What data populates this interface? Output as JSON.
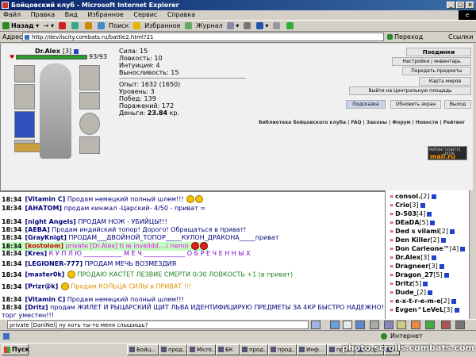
{
  "window": {
    "title": "Бойцовский клуб - Microsoft Internet Explorer"
  },
  "menu": [
    "Файл",
    "Правка",
    "Вид",
    "Избранное",
    "Сервис",
    "Справка"
  ],
  "toolbar": {
    "back": "Назад",
    "search": "Поиск",
    "favorites": "Избранное",
    "journal": "Журнал"
  },
  "address": {
    "label": "Адрес",
    "url": "http://devilscity.combats.ru/battle2.html?21",
    "go": "Переход",
    "links": "Ссылки"
  },
  "character": {
    "name": "Dr.Alex",
    "level": "[3]",
    "hp": "93/93",
    "hp_fraction": 1.0
  },
  "stats": [
    {
      "label": "Сила:",
      "value": "15"
    },
    {
      "label": "Ловкость:",
      "value": "10"
    },
    {
      "label": "Интуиция:",
      "value": "4"
    },
    {
      "label": "Выносливость:",
      "value": "15"
    }
  ],
  "exp": [
    {
      "label": "Опыт:",
      "value": "1632 (1650)"
    },
    {
      "label": "Уровень:",
      "value": "3"
    },
    {
      "label": "Побед:",
      "value": "139"
    },
    {
      "label": "Поражений:",
      "value": "172"
    },
    {
      "label": "Деньги:",
      "value": "23.84",
      "suffix": "кр."
    }
  ],
  "right_buttons": [
    "Поединки",
    "Настройки / инвентарь",
    "Передать предметы",
    "Карта миров",
    "Выйти на Центральную площадь"
  ],
  "bottom_buttons": [
    "Подсказка",
    "Обновить экран",
    "Выход"
  ],
  "library_links": "Библиотека бойцовского клуба | FAQ | Законы | Форум | Новости | Рейтинг",
  "counter": {
    "label": "РЕЙТИНГ",
    "nums": "74584715 20729",
    "brand": "mail.ru"
  },
  "chat": [
    {
      "time": "18:34",
      "user": "[Vitamin C]",
      "text": "Продам немецкий полный шлем!!!",
      "color": "#00007a"
    },
    {
      "time": "18:34",
      "user": "[АНАТОМ]",
      "text": "продам кинжал -Царский- 4/50 - приват =",
      "color": "#00007a"
    },
    {
      "time": "18:34",
      "user": "[night Angels]",
      "text": "ПРОДАМ НОЖ - УБИЙЦЫ!!!",
      "color": "#00007a"
    },
    {
      "time": "18:34",
      "user": "[АЕВА]",
      "text": "Продам индийский топор! Дорого! Обращаться в приват!",
      "color": "#00007a"
    },
    {
      "time": "18:34",
      "user": "[GrayKnigt]",
      "text": "ПРОДАМ___ДВОЙНОЙ_ТОПОР_____КУЛОН_ДРАКОНА_____приват",
      "color": "#00007a"
    },
    {
      "time": "18:34",
      "user": "[kostolom]",
      "text": "private [Dr.Alex] ti ie invalidd....i nemo",
      "color": "#ff00ff",
      "private": true
    },
    {
      "time": "18:34",
      "user": "[Kres]",
      "text": "К У П Л Ю ____________ М Е Ч _____________ О Б Р Е Ч Е Н Н Ы Х",
      "color": "#7a00c8"
    },
    {
      "time": "18:34",
      "user": "[LEGIONER-777]",
      "text": "ПРОДАМ МЕЧЬ ВОЗМЕЗДИЯ",
      "color": "#00007a"
    },
    {
      "time": "18:34",
      "user": "[master0k]",
      "text": "ПРОДАЮ КАСТЕТ ЛЕЗВИЕ СМЕРТИ 0/30 ЛОВКОСТЬ +1 (в приват)",
      "color": "#208020"
    },
    {
      "time": "18:34",
      "user": "[Prizr@k]",
      "text": "Продам КОЛЬЦА СИЛЫ в ПРИВАТ !!!",
      "color": "#e09000"
    },
    {
      "time": "18:34",
      "user": "[Vitamin C]",
      "text": "Продам немецкий полный шлем!!!",
      "color": "#00007a"
    },
    {
      "time": "18:34",
      "user": "[Dritz]",
      "text": "продам ЖИЛЕТ И РЫЦАРСКИЙ ЩИТ ЛЬВА ИДЕНТИФИЦИРУЮ ПРЕДМЕТЫ ЗА 4КР БЫСТРО НАДЕЖНО!!!!",
      "color": "#00007a"
    },
    {
      "time": "",
      "user": "",
      "text": "торг уместен!!!",
      "color": "#00007a"
    }
  ],
  "users": [
    {
      "name": "consol.",
      "lvl": "[2]"
    },
    {
      "name": "Crio",
      "lvl": "[3]"
    },
    {
      "name": "D-503",
      "lvl": "[4]"
    },
    {
      "name": "DEaDA",
      "lvl": "[5]"
    },
    {
      "name": "Ded s vilami",
      "lvl": "[2]"
    },
    {
      "name": "Den Killer",
      "lvl": "[2]"
    },
    {
      "name": "Don Carleone™",
      "lvl": "[4]"
    },
    {
      "name": "Dr.Alex",
      "lvl": "[3]"
    },
    {
      "name": "Dragneer",
      "lvl": "[3]"
    },
    {
      "name": "Dragon_27",
      "lvl": "[5]"
    },
    {
      "name": "Dritz",
      "lvl": "[5]"
    },
    {
      "name": "Dude_",
      "lvl": "[2]"
    },
    {
      "name": "e-x-t-r-e-m-e",
      "lvl": "[2]"
    },
    {
      "name": "Evgen^LeVeL",
      "lvl": "[3]"
    }
  ],
  "chat_input": "private [DaniNel] ну хоть ты-то меня слышишь?",
  "status": {
    "zone": "Интернет"
  },
  "taskbar": {
    "start": "Пуск",
    "tasks": [
      "Бойц...",
      "прод...",
      "Micro...",
      "БК",
      "прод...",
      "прод...",
      "Инф...",
      "прод...",
      "Инф...",
      "на в..."
    ]
  },
  "watermark": "photo.scrolls.combats.com"
}
